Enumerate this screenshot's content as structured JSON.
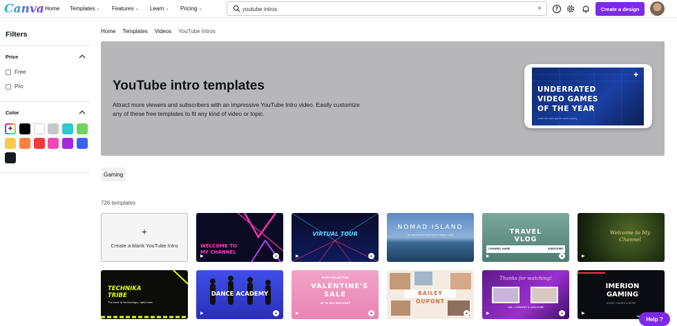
{
  "brand": {
    "name": "Canva"
  },
  "nav": {
    "home": "Home",
    "templates": "Templates",
    "features": "Features",
    "learn": "Learn",
    "pricing": "Pricing"
  },
  "search": {
    "value": "youtube intros",
    "clear": "×"
  },
  "header": {
    "create_label": "Create a design",
    "help_label": "Help",
    "help_glyph": "?"
  },
  "sidebar": {
    "title": "Filters",
    "price": {
      "title": "Price",
      "options": [
        "Free",
        "Pro"
      ]
    },
    "color": {
      "title": "Color",
      "swatches": [
        "multicolor",
        "#000000",
        "#ffffff",
        "#c4c9cc",
        "#2fc8d3",
        "#6fd35a",
        "#f9c94b",
        "#ff7f3f",
        "#f03c3c",
        "#f447b7",
        "#a526e0",
        "#3e5ef5",
        "#16191d"
      ]
    }
  },
  "breadcrumb": [
    "Home",
    "Templates",
    "Videos",
    "YouTube Intros"
  ],
  "hero": {
    "title": "YouTube intro templates",
    "description": "Attract more viewers and subscribers with an impressive YouTube Intro video. Easily customize any of these free templates to fit any kind of video or topic.",
    "preview_lines": [
      "UNDERRATED",
      "VIDEO GAMES",
      "OF THE YEAR"
    ],
    "preview_sub": "under-the-radar games worth playing"
  },
  "chip": "Gaming",
  "count": "726 templates",
  "blank_card": {
    "plus": "+",
    "label": "Create a blank YouTube Intro"
  },
  "templates": [
    {
      "name": "Welcome to my channel",
      "text": "WELCOME TO MY CHANNEL"
    },
    {
      "name": "Virtual tour",
      "text": "VIRTUAL TOUR"
    },
    {
      "name": "Nomad Island",
      "text": "NOMAD ISLAND",
      "sub": "an adventure travel and creative vlog"
    },
    {
      "name": "Travel vlog",
      "text": "TRAVEL VLOG",
      "sub1": "CHANNEL NAME",
      "sub2": "SUBSCRIBE"
    },
    {
      "name": "Welcome to my channel forest",
      "text": "Welcome to My Channel"
    },
    {
      "name": "Technika Tribe",
      "text": "TECHNIKA TRIBE",
      "sub": "The best of technology, right here"
    },
    {
      "name": "Dance Academy",
      "text": "DANCE ACADEMY"
    },
    {
      "name": "Valentine's Sale",
      "text": "VALENTINE'S SALE",
      "top": "FLASH COLLECTION",
      "sub": "UP TO 50% DISCOUNT"
    },
    {
      "name": "Bailey Dupont",
      "text": "BAILEY DUPONT"
    },
    {
      "name": "Thanks for watching",
      "text": "Thanks for watching!",
      "sub": "LIKE, COMMENT & SUBSCRIBE"
    },
    {
      "name": "Imerion Gaming",
      "text": "IMERION GAMING",
      "sub": "GAMES, GAMES & MORE"
    }
  ]
}
